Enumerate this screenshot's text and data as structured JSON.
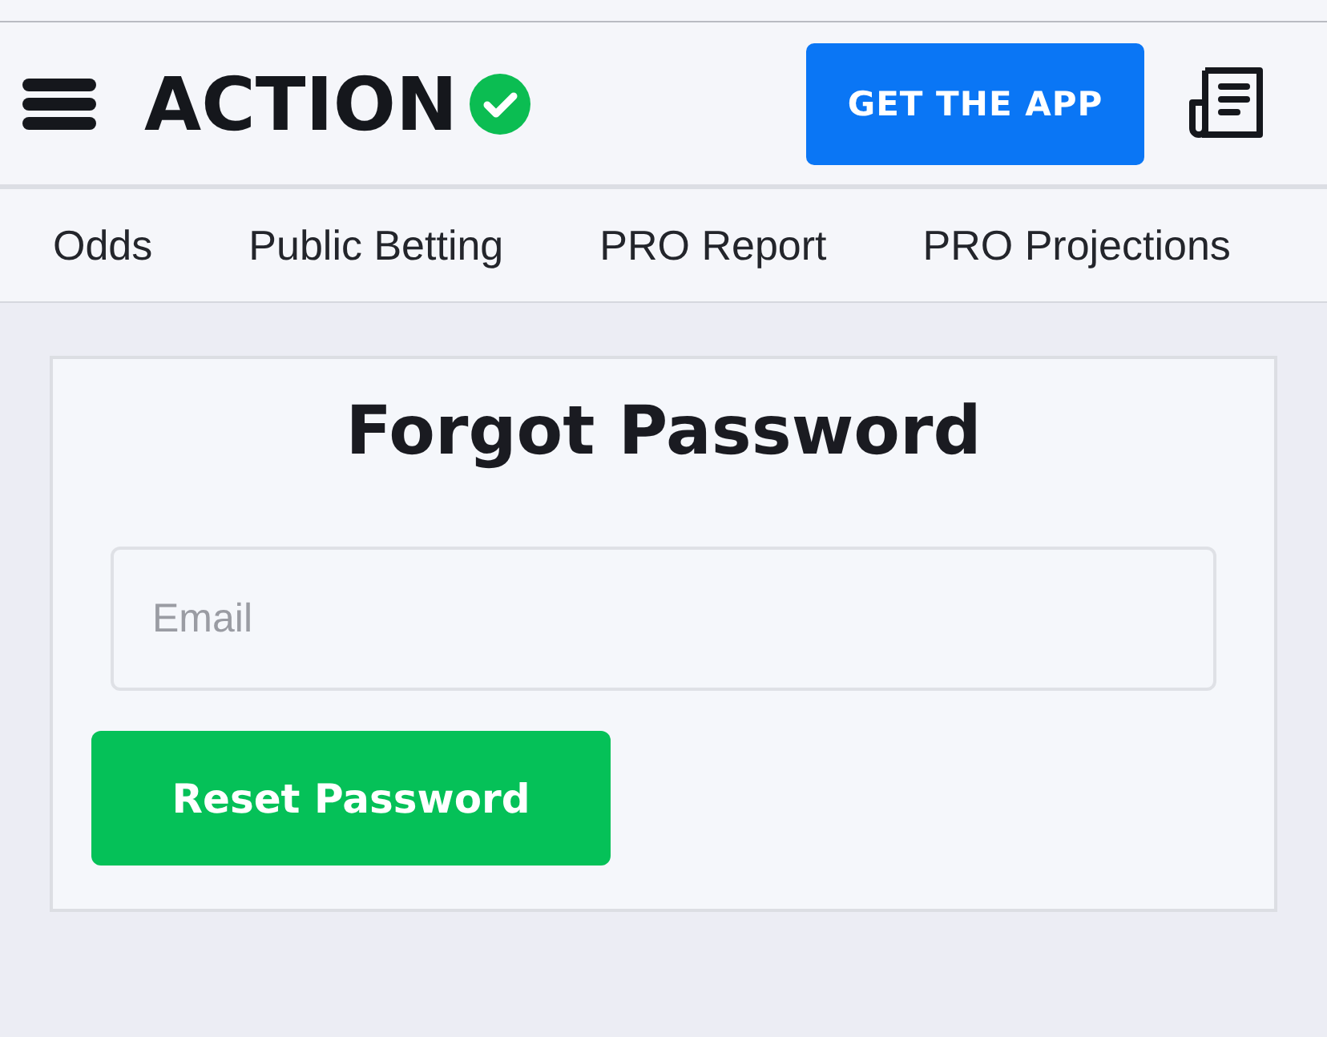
{
  "header": {
    "logo": "ACTION",
    "app_button": "GET THE APP"
  },
  "nav": {
    "items": [
      {
        "label": "Odds"
      },
      {
        "label": "Public Betting"
      },
      {
        "label": "PRO Report"
      },
      {
        "label": "PRO Projections"
      }
    ]
  },
  "form": {
    "title": "Forgot Password",
    "email": {
      "placeholder": "Email"
    },
    "submit": "Reset Password"
  }
}
